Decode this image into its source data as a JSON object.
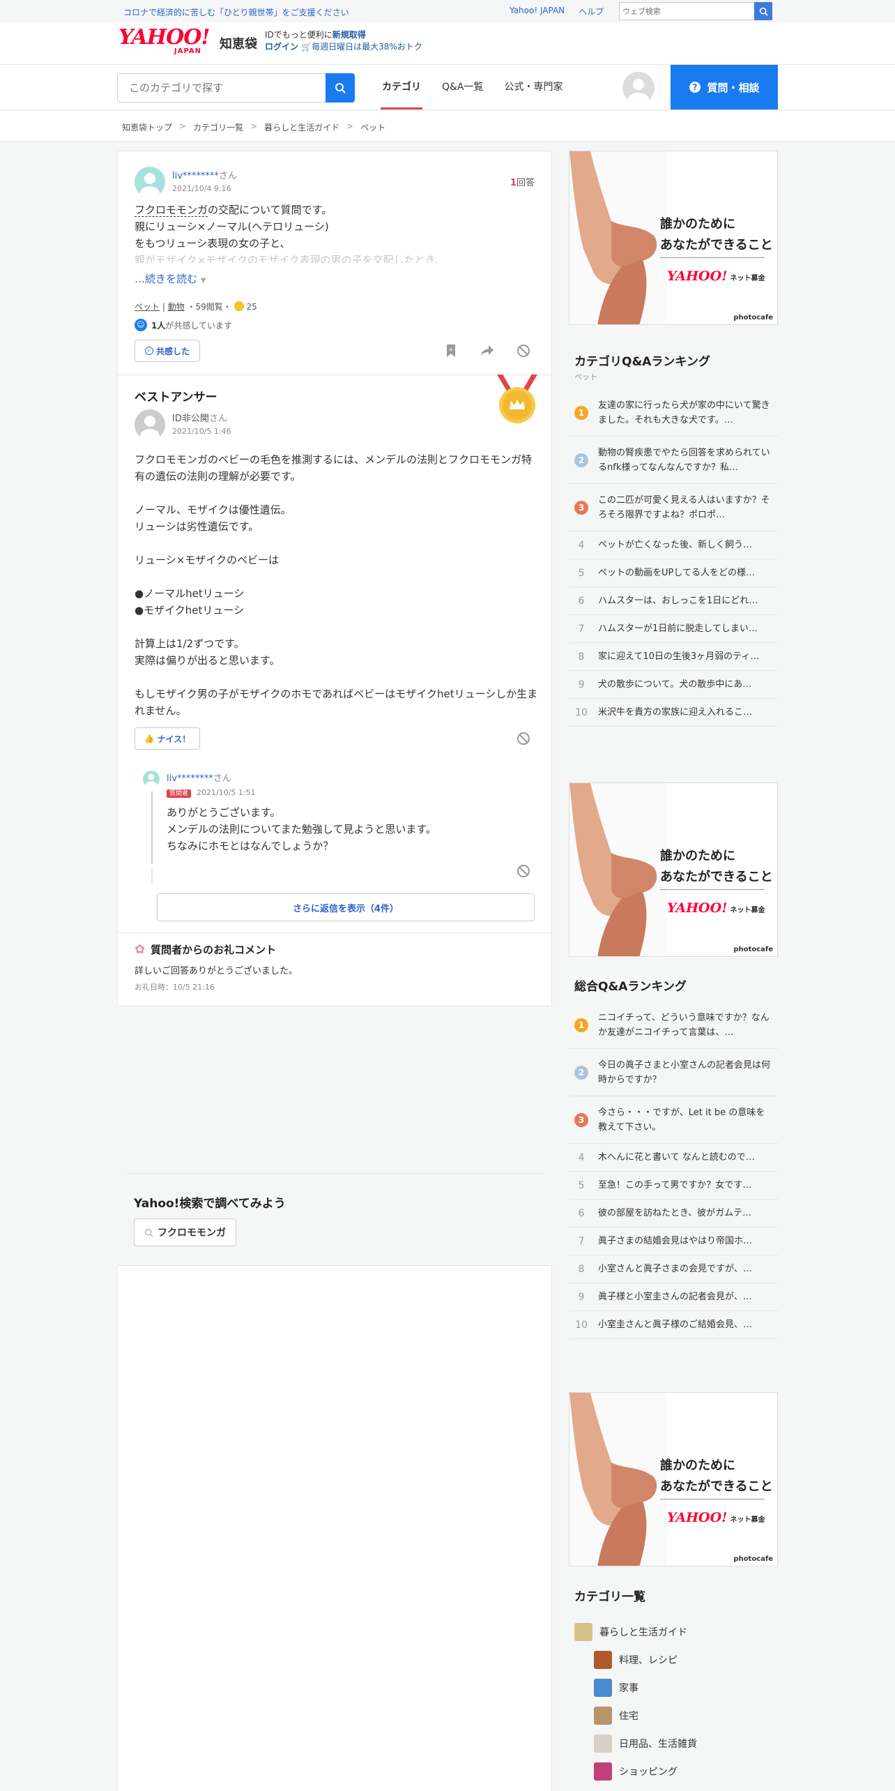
{
  "masthead": {
    "notice": "コロナで経済的に苦しむ「ひとり親世帯」をご支援ください",
    "links": [
      "Yahoo! JAPAN",
      "ヘルプ"
    ],
    "web_search_placeholder": "ウェブ検索"
  },
  "brand": {
    "logo_text": "YAHOO!",
    "logo_sub": "JAPAN",
    "service_name": "知恵袋",
    "promo_line1_prefix": "IDでもっと便利に",
    "promo_line1_link": "新規取得",
    "promo_line2_login": "ログイン",
    "promo_line2_text": "毎週日曜日は最大38%おトク"
  },
  "nav": {
    "search_placeholder": "このカテゴリで探す",
    "tabs": [
      "カテゴリ",
      "Q&A一覧",
      "公式・専門家"
    ],
    "ask_button": "質問・相談"
  },
  "breadcrumb": [
    "知恵袋トップ",
    "カテゴリ一覧",
    "暮らしと生活ガイド",
    "ペット"
  ],
  "question": {
    "user": "liv********",
    "user_suffix": "さん",
    "date": "2021/10/4 9:16",
    "answer_count": "1",
    "answer_label": "回答",
    "line1_link": "フクロモモンガ",
    "line1_rest": "の交配について質問です。",
    "line2": "親にリューシ×ノーマル(ヘテロリューシ)",
    "line3": "をもつリューシ表現の女の子と、",
    "line4": "親がモザイク×モザイクのモザイク表現の男の子を交配したとき、",
    "read_more": "…続きを読む",
    "tag1": "ペット",
    "tag2": "動物",
    "views": "59閲覧",
    "coins": "25",
    "empathy_count": "1人",
    "empathy_text": "が共感しています",
    "empathy_button": "共感した"
  },
  "best_answer": {
    "title": "ベストアンサー",
    "user": "ID非公開",
    "user_suffix": "さん",
    "date": "2021/10/5 1:46",
    "text": "フクロモモンガのベビーの毛色を推測するには、メンデルの法則とフクロモモンガ特有の遺伝の法則の理解が必要です。\n\nノーマル、モザイクは優性遺伝。\nリューシは劣性遺伝です。\n\nリューシ×モザイクのベビーは\n\n●ノーマルhetリューシ\n●モザイクhetリューシ\n\n計算上は1/2ずつです。\n実際は偏りが出ると思います。\n\nもしモザイク男の子がモザイクのホモであればベビーはモザイクhetリューシしか生まれません。",
    "nice_button": "ナイス！"
  },
  "reply": {
    "user": "liv********",
    "user_suffix": "さん",
    "badge": "質問者",
    "date": "2021/10/5 1:51",
    "line1": "ありがとうございます。",
    "line2": "メンデルの法則についてまた勉強して見ようと思います。",
    "line3": "ちなみにホモとはなんでしょうか？",
    "more_replies": "さらに返信を表示（4件）"
  },
  "thanks": {
    "title": "質問者からのお礼コメント",
    "text": "詳しいご回答ありがとうございました。",
    "date": "お礼日時：10/5 21:16"
  },
  "yahoo_search": {
    "title": "Yahoo!検索で調べてみよう",
    "chip": "フクロモモンガ"
  },
  "ad": {
    "line1": "誰かのために",
    "line2": "あなたができること",
    "logo": "YAHOO!",
    "logo_sub": "ネット募金",
    "credit": "photocafe"
  },
  "category_ranking": {
    "title": "カテゴリQ&Aランキング",
    "subtitle": "ペット",
    "items": [
      "友達の家に行ったら犬が家の中にいて驚きました。それも大きな犬です。…",
      "動物の腎疾患でやたら回答を求められているnfk様ってなんなんですか？私…",
      "この二匹が可愛く見える人はいますか？そろそろ限界ですよね？ポロポ…",
      "ペットが亡くなった後、新しく飼う…",
      "ペットの動画をUPしてる人をどの様…",
      "ハムスターは、おしっこを1日にどれ…",
      "ハムスターが1日前に脱走してしまい…",
      "家に迎えて10日の生後3ヶ月弱のティ…",
      "犬の散歩について。犬の散歩中にあ…",
      "米沢牛を貴方の家族に迎え入れるこ…"
    ]
  },
  "overall_ranking": {
    "title": "総合Q&Aランキング",
    "items": [
      "ニコイチって、どういう意味ですか？なんか友達がニコイチって言葉は、…",
      "今日の眞子さまと小室さんの記者会見は何時からですか？",
      "今さら・・・ですが、Let it be の意味を教えて下さい。",
      "木へんに花と書いて なんと読むので…",
      "至急！この手って男ですか？女です…",
      "彼の部屋を訪ねたとき、彼がガムテ…",
      "眞子さまの結婚会見はやはり帝国ホ…",
      "小室さんと眞子さまの会見ですが、…",
      "眞子様と小室圭さんの記者会見が、…",
      "小室圭さんと眞子様のご結婚会見、…"
    ]
  },
  "categories": {
    "title": "カテゴリ一覧",
    "items": [
      "暮らしと生活ガイド",
      "料理、レシピ",
      "家事",
      "住宅",
      "日用品、生活雑貨",
      "ショッピング"
    ]
  },
  "colors": {
    "accent_blue": "#1a7af0",
    "link_blue": "#3064c8",
    "yahoo_red": "#ff0033",
    "rank_gold": "#f5a623",
    "rank_silver": "#aac4dc",
    "rank_bronze": "#e8785a"
  }
}
